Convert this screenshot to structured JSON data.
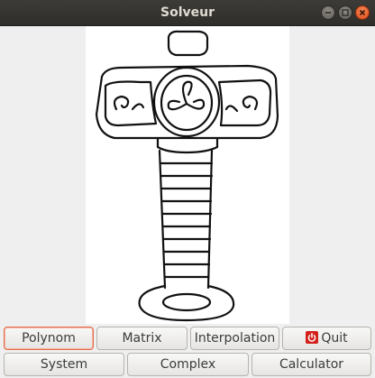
{
  "window": {
    "title": "Solveur"
  },
  "colors": {
    "titlebar": "#3c3b37",
    "close": "#df4a16",
    "focus_border": "#e26d4e",
    "quit_icon": "#d3201a"
  },
  "buttons": {
    "row1": [
      {
        "label": "Polynom",
        "focused": true
      },
      {
        "label": "Matrix"
      },
      {
        "label": "Interpolation"
      },
      {
        "label": "Quit",
        "icon": "power-icon"
      }
    ],
    "row2": [
      {
        "label": "System"
      },
      {
        "label": "Complex"
      },
      {
        "label": "Calculator"
      }
    ]
  }
}
